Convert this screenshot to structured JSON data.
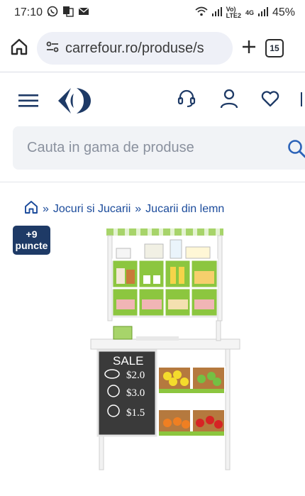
{
  "status_bar": {
    "time": "17:10",
    "battery": "45%",
    "net_top": "Vo)",
    "net_bottom": "LTE2",
    "net_4g": "4G"
  },
  "browser": {
    "url": "carrefour.ro/produse/s",
    "tab_count": "15"
  },
  "search": {
    "placeholder": "Cauta in gama de produse"
  },
  "breadcrumb": {
    "items": [
      "Jocuri si Jucarii",
      "Jucarii din lemn"
    ],
    "separator": "»"
  },
  "points_badge": {
    "value": "+9",
    "label": "puncte"
  },
  "product_image": {
    "sign": "SALE",
    "prices": [
      "$2.0",
      "$3.0",
      "$1.5"
    ]
  },
  "colors": {
    "brand_blue": "#1e3a66",
    "accent_green": "#8cc63f",
    "link_blue": "#1b4b9b"
  }
}
